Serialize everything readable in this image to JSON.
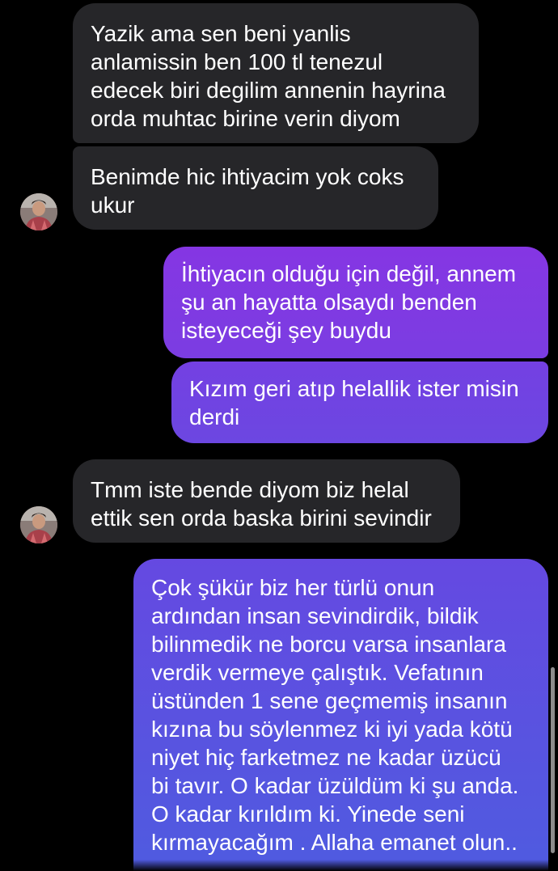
{
  "colors": {
    "background": "#000000",
    "incoming_bubble": "#262629",
    "outgoing_gradient_top": "#7c3ae0",
    "outgoing_gradient_bottom": "#4a5ce0"
  },
  "messages": [
    {
      "direction": "incoming",
      "text": "Yazik ama sen beni yanlis\nanlamissin ben 100 tl tenezul\nedecek biri degilim annenin hayrina\norda muhtac birine verin diyom"
    },
    {
      "direction": "incoming",
      "text": "Benimde hic ihtiyacim yok coks\nukur"
    },
    {
      "direction": "outgoing",
      "text": "İhtiyacın olduğu için değil, annem\nşu an hayatta olsaydı benden\nisteyeceği şey buydu"
    },
    {
      "direction": "outgoing",
      "text": "Kızım geri atıp helallik ister misin\nderdi"
    },
    {
      "direction": "incoming",
      "text": "Tmm iste bende diyom biz helal\nettik sen orda baska birini sevindir"
    },
    {
      "direction": "outgoing",
      "text": "Çok şükür biz her türlü onun\nardından insan sevindirdik, bildik\nbilinmedik ne borcu varsa insanlara\nverdik vermeye çalıştık. Vefatının\nüstünden 1 sene geçmemiş insanın\nkızına bu söylenmez ki  iyi yada kötü\nniyet hiç farketmez ne kadar üzücü\nbi tavır. O kadar üzüldüm ki şu anda.\nO kadar kırıldım ki. Yinede seni\nkırmayacağım . Allaha emanet olun.."
    }
  ]
}
